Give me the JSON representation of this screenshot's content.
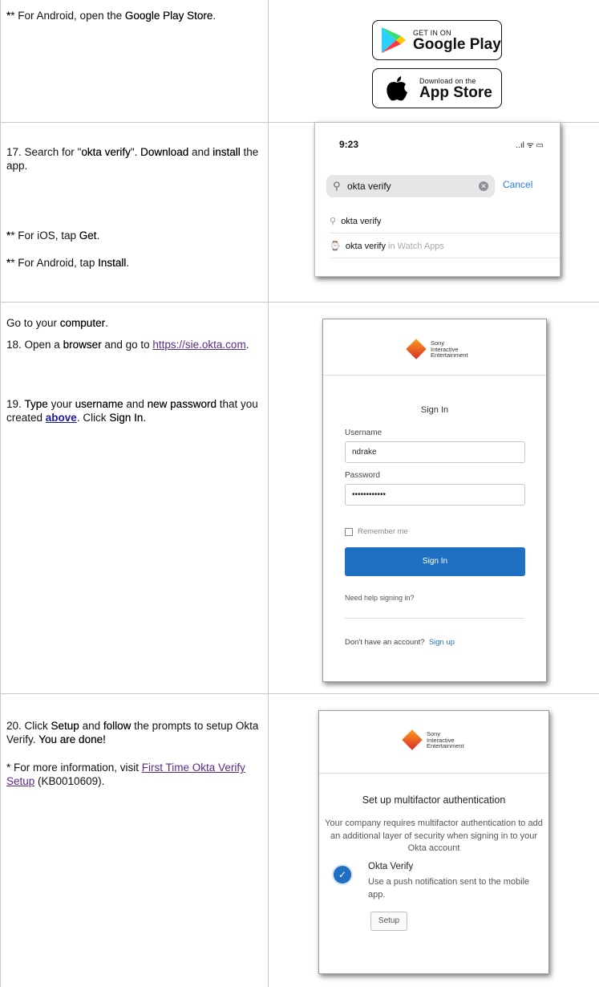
{
  "rows": {
    "row0": {
      "text_parts": [
        "* For Android, open the ",
        "Google Play Store",
        "."
      ],
      "badges": {
        "google": {
          "small": "GET IN ON",
          "big": "Google Play"
        },
        "apple": {
          "small": "Download on the",
          "big": "App Store"
        }
      }
    },
    "row1": {
      "step_parts": [
        "17. Search for \"",
        "okta verify",
        "\". ",
        "Download",
        " and ",
        "install",
        " the app."
      ],
      "ios_parts": [
        "* For iOS, tap ",
        "Get",
        "."
      ],
      "android_parts": [
        "* For Android, tap ",
        "Install",
        "."
      ],
      "phone": {
        "time": "9:23",
        "status": "..ıl ᯤ ▭",
        "search_value": "okta verify",
        "cancel": "Cancel",
        "suggestion": "okta verify",
        "watch_bold": "okta verify",
        "watch_muted": " in Watch Apps"
      }
    },
    "row2": {
      "line1_parts": [
        "Go to your ",
        "computer",
        "."
      ],
      "step18_parts": [
        "18. Open a ",
        "browser",
        " and go to "
      ],
      "step18_link": "https://sie.okta.com",
      "step18_end": ".",
      "step19_parts": [
        "19. ",
        "Type",
        " your ",
        "username",
        " and ",
        "new password",
        " that you created "
      ],
      "step19_link": "above",
      "step19_tail": [
        ". Click ",
        "Sign In",
        "."
      ],
      "card": {
        "logo": [
          "Sony",
          "Interactive",
          "Entertainment"
        ],
        "title": "Sign In",
        "username_label": "Username",
        "username_value": "ndrake",
        "password_label": "Password",
        "password_value": "••••••••••••",
        "remember": "Remember me",
        "button": "Sign In",
        "help": "Need help signing in?",
        "no_account": "Don't have an account?",
        "signup": "Sign up"
      }
    },
    "row3": {
      "step20_parts": [
        "20. Click ",
        "Setup",
        " and ",
        "follow",
        " the prompts to setup Okta Verify. ",
        "You are done!"
      ],
      "info_prefix": "* For more information, visit ",
      "info_link": "First Time Okta Verify Setup",
      "info_suffix": " (KB0010609).",
      "card": {
        "logo": [
          "Sony",
          "Interactive",
          "Entertainment"
        ],
        "title": "Set up multifactor authentication",
        "desc": "Your company requires multifactor authentication to add an additional layer of security when signing in to your Okta account",
        "factor_name": "Okta Verify",
        "factor_desc": "Use a push notification sent to the mobile app.",
        "button": "Setup"
      }
    }
  }
}
